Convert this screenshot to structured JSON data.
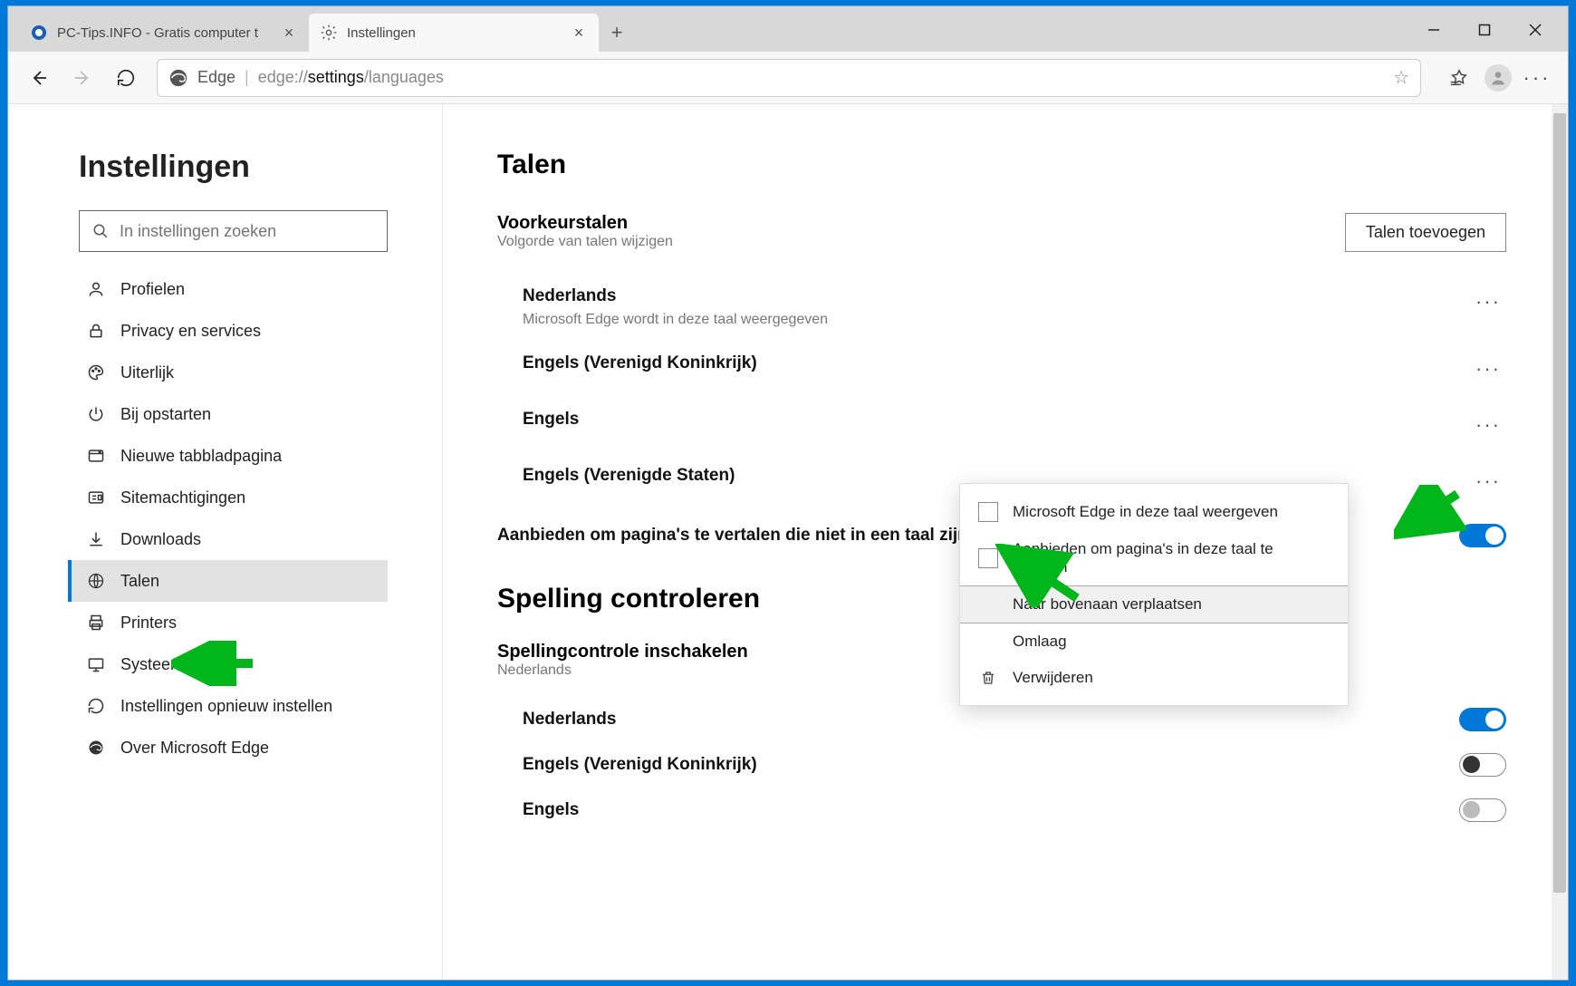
{
  "tabs": [
    {
      "title": "PC-Tips.INFO - Gratis computer t",
      "active": false
    },
    {
      "title": "Instellingen",
      "active": true
    }
  ],
  "address": {
    "scheme_label": "Edge",
    "url_prefix": "edge://",
    "url_bold": "settings",
    "url_rest": "/languages"
  },
  "sidebar": {
    "title": "Instellingen",
    "search_placeholder": "In instellingen zoeken",
    "items": [
      {
        "label": "Profielen"
      },
      {
        "label": "Privacy en services"
      },
      {
        "label": "Uiterlijk"
      },
      {
        "label": "Bij opstarten"
      },
      {
        "label": "Nieuwe tabbladpagina"
      },
      {
        "label": "Sitemachtigingen"
      },
      {
        "label": "Downloads"
      },
      {
        "label": "Talen",
        "active": true
      },
      {
        "label": "Printers"
      },
      {
        "label": "Systeem"
      },
      {
        "label": "Instellingen opnieuw instellen"
      },
      {
        "label": "Over Microsoft Edge"
      }
    ]
  },
  "main": {
    "heading": "Talen",
    "pref_langs_heading": "Voorkeurstalen",
    "pref_langs_desc": "Volgorde van talen wijzigen",
    "add_lang_button": "Talen toevoegen",
    "languages": [
      {
        "name": "Nederlands",
        "sub": "Microsoft Edge wordt in deze taal weergegeven"
      },
      {
        "name": "Engels (Verenigd Koninkrijk)"
      },
      {
        "name": "Engels"
      },
      {
        "name": "Engels (Verenigde Staten)"
      }
    ],
    "translate_offer_label": "Aanbieden om pagina's te vertalen die niet in een taal zijn die u leest",
    "spell_heading": "Spelling controleren",
    "spell_enable_heading": "Spellingcontrole inschakelen",
    "spell_enable_sub": "Nederlands",
    "spell_langs": [
      {
        "name": "Nederlands",
        "on": true
      },
      {
        "name": "Engels (Verenigd Koninkrijk)",
        "on": false
      },
      {
        "name": "Engels",
        "on": false,
        "light": true
      }
    ]
  },
  "context_menu": {
    "opt_display": "Microsoft Edge in deze taal weergeven",
    "opt_translate": "Aanbieden om pagina's in deze taal te vertalen",
    "move_top": "Naar bovenaan verplaatsen",
    "move_down": "Omlaag",
    "delete": "Verwijderen"
  }
}
